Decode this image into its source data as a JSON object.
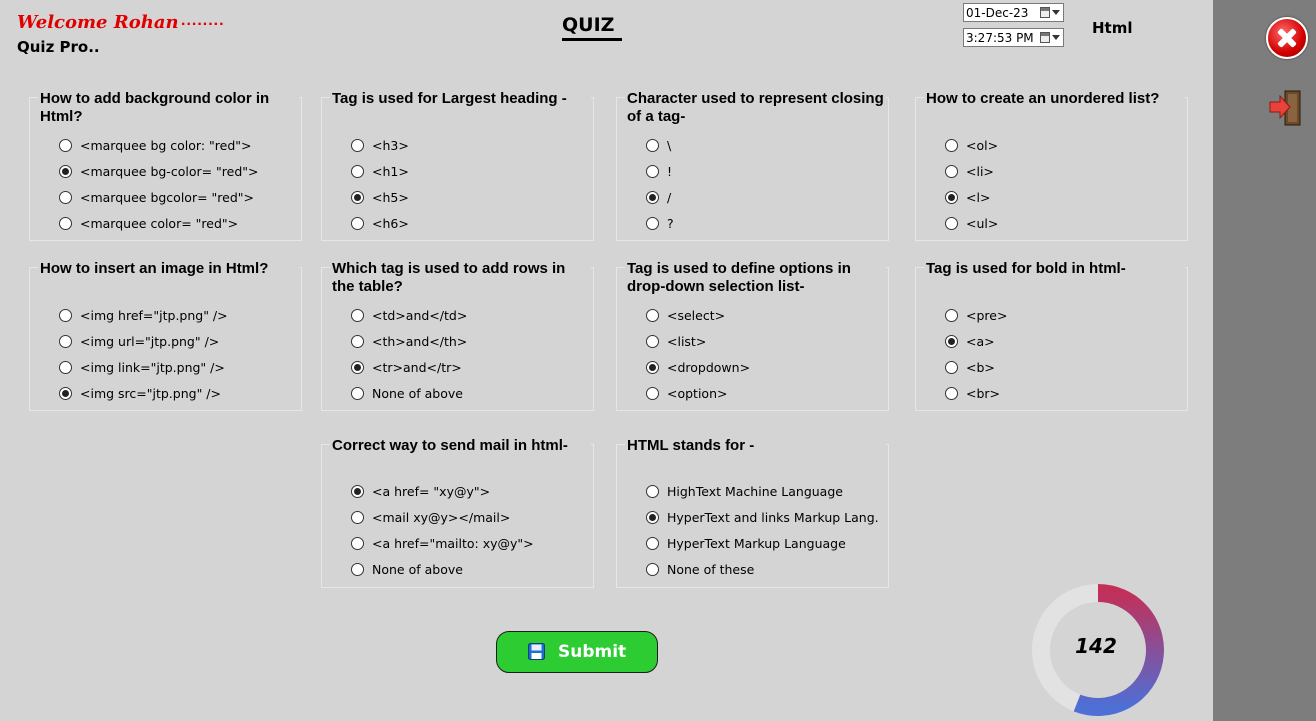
{
  "header": {
    "welcome": "Welcome Rohan",
    "dots": "........",
    "app_name": "Quiz Pro..",
    "title": "QUIZ",
    "date": "01-Dec-23",
    "time": "3:27:53 PM",
    "subject": "Html"
  },
  "questions": [
    {
      "title": "How to add background color in Html?",
      "options": [
        "<marquee bg color: \"red\">",
        "<marquee bg-color= \"red\">",
        "<marquee bgcolor= \"red\">",
        "<marquee color= \"red\">"
      ],
      "selected": 1
    },
    {
      "title": "Tag is used for Largest heading -",
      "options": [
        "<h3>",
        "<h1>",
        "<h5>",
        "<h6>"
      ],
      "selected": 2
    },
    {
      "title": "Character used to represent closing of a tag-",
      "options": [
        "\\",
        "!",
        " /",
        "?"
      ],
      "selected": 2
    },
    {
      "title": "How to create an unordered list?",
      "options": [
        "<ol>",
        "<li>",
        "<l>",
        "<ul>"
      ],
      "selected": 2
    },
    {
      "title": "How to insert an image in Html?",
      "options": [
        "<img href=\"jtp.png\" />",
        "<img url=\"jtp.png\" />",
        "<img link=\"jtp.png\" />",
        "<img src=\"jtp.png\" />"
      ],
      "selected": 3
    },
    {
      "title": "Which tag is used to add rows in the table?",
      "options": [
        "<td>and</td>",
        "<th>and</th>",
        "<tr>and</tr>",
        "None of above"
      ],
      "selected": 2
    },
    {
      "title": "Tag is used to define options in drop-down selection list-",
      "options": [
        "<select>",
        "<list>",
        "<dropdown>",
        "<option>"
      ],
      "selected": 2
    },
    {
      "title": "Tag is used for bold in html-",
      "options": [
        "<pre>",
        "<a>",
        "<b>",
        "<br>"
      ],
      "selected": 1
    },
    {
      "title": "Correct way to send mail in html-",
      "options": [
        "<a href= \"xy@y\">",
        "<mail xy@y></mail>",
        "<a href=\"mailto: xy@y\">",
        "None of above"
      ],
      "selected": 0
    },
    {
      "title": "HTML stands for -",
      "options": [
        "HighText Machine Language",
        "HyperText and links Markup Lang.",
        "HyperText Markup Language",
        "None of these"
      ],
      "selected": 1
    }
  ],
  "submit_label": "Submit",
  "timer": {
    "value": "142",
    "fraction": 0.56,
    "color_start": "#c2305a",
    "color_end": "#4d6fd6",
    "track_color": "#e2e2e2"
  },
  "icons": {
    "close": "close-icon",
    "exit": "exit-door-icon",
    "submit": "save-disk-icon",
    "calendar": "calendar-icon"
  }
}
